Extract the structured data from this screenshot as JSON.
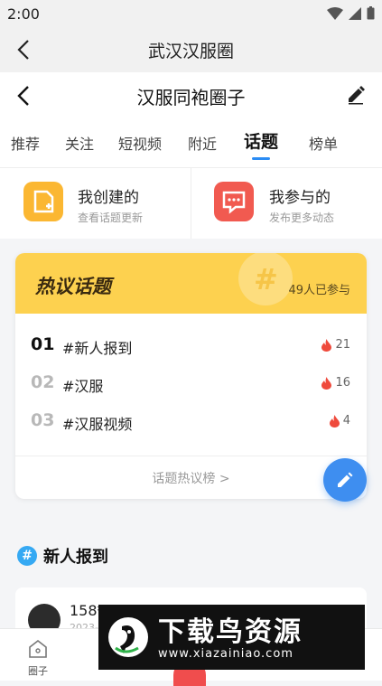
{
  "status": {
    "time": "2:00"
  },
  "outer_header": {
    "title": "武汉汉服圈"
  },
  "inner_header": {
    "title": "汉服同袍圈子"
  },
  "tabs": [
    {
      "label": "推荐"
    },
    {
      "label": "关注"
    },
    {
      "label": "短视频"
    },
    {
      "label": "附近"
    },
    {
      "label": "话题",
      "active": true
    },
    {
      "label": "榜单"
    }
  ],
  "quick": {
    "created": {
      "title": "我创建的",
      "subtitle": "查看话题更新"
    },
    "joined": {
      "title": "我参与的",
      "subtitle": "发布更多动态"
    }
  },
  "hot": {
    "title": "热议话题",
    "count": "49人已参与",
    "items": [
      {
        "rank": "01",
        "topic": "#新人报到",
        "heat": "21"
      },
      {
        "rank": "02",
        "topic": "#汉服",
        "heat": "16"
      },
      {
        "rank": "03",
        "topic": "#汉服视频",
        "heat": "4"
      }
    ],
    "more": "话题热议榜 >"
  },
  "section": {
    "title": "新人报到",
    "icon": "#"
  },
  "post": {
    "name": "158*",
    "date": "2023-"
  },
  "bottom_nav": {
    "home": "圈子"
  },
  "watermark": {
    "text": "下载鸟资源",
    "url": "www.xiazainiao.com"
  },
  "colors": {
    "accent": "#2b8cf4",
    "hot_banner": "#fdd14f",
    "flame": "#ef4a3c",
    "fab": "#3e8ef0"
  }
}
